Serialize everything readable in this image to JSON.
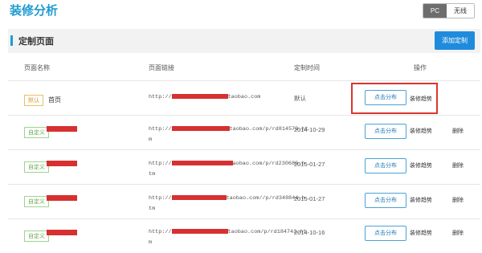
{
  "header": {
    "title": "装修分析",
    "toggle": {
      "pc": "PC",
      "wireless": "无线"
    }
  },
  "section": {
    "title": "定制页面",
    "add_button": "添加定制"
  },
  "table": {
    "columns": {
      "name": "页面名称",
      "link": "页面链接",
      "time": "定制时间",
      "action": "操作"
    },
    "rows": [
      {
        "tag": "默认",
        "name": "首页",
        "url1": "http://",
        "url2": "taobao.com",
        "url3": "",
        "time": "默认"
      },
      {
        "tag": "自定义",
        "name": "",
        "url1": "http://",
        "url2": "taobao.com/p/rd814570.ht",
        "url3": "m",
        "time": "2014-10-29"
      },
      {
        "tag": "自定义",
        "name": "",
        "url1": "http://",
        "url2": "aobao.com/p/rd230680.h",
        "url3": "tm",
        "time": "2015-01-27"
      },
      {
        "tag": "自定义",
        "name": "",
        "url1": "http://",
        "url2": "taobao.com//p/rd348844.h",
        "url3": "tm",
        "time": "2015-01-27"
      },
      {
        "tag": "自定义",
        "name": "",
        "url1": "http://",
        "url2": "taobao.com/p/rd184743.ht",
        "url3": "m",
        "time": "2014-10-16"
      }
    ],
    "actions": {
      "click_dist": "点击分布",
      "trend": "装修趋势",
      "delete": "删除"
    }
  }
}
